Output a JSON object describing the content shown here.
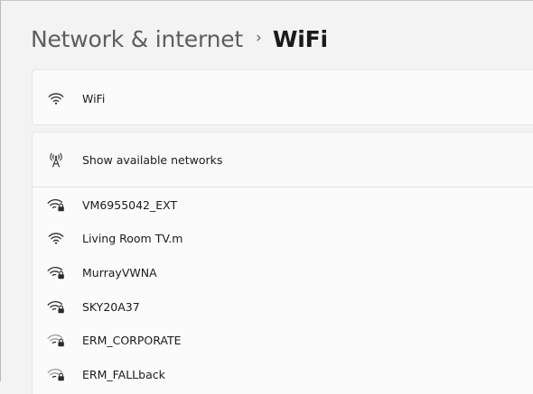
{
  "breadcrumb": {
    "parent": "Network & internet",
    "separator": "›",
    "current": "WiFi"
  },
  "wifi_card": {
    "icon": "wifi-icon",
    "label": "WiFi"
  },
  "show_networks": {
    "icon": "antenna-icon",
    "label": "Show available networks"
  },
  "networks": [
    {
      "name": "VM6955042_EXT",
      "secured": true,
      "icon": "wifi-secured-icon"
    },
    {
      "name": "Living Room TV.m",
      "secured": false,
      "icon": "wifi-icon"
    },
    {
      "name": "MurrayVWNA",
      "secured": true,
      "icon": "wifi-secured-icon"
    },
    {
      "name": "SKY20A37",
      "secured": true,
      "icon": "wifi-secured-icon"
    },
    {
      "name": "ERM_CORPORATE",
      "secured": true,
      "icon": "wifi-secured-icon"
    },
    {
      "name": "ERM_FALLback",
      "secured": true,
      "icon": "wifi-secured-icon"
    }
  ]
}
